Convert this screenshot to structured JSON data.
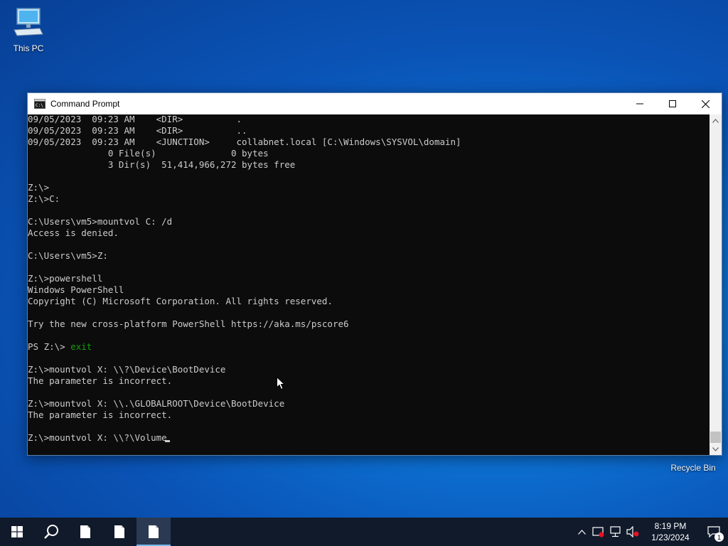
{
  "desktop": {
    "icons": [
      {
        "label": "This PC"
      },
      {
        "label": "Recycle Bin"
      }
    ]
  },
  "window": {
    "title": "Command Prompt",
    "colors": {
      "console_bg": "#0c0c0c",
      "console_fg": "#cccccc",
      "highlight": "#13a10e"
    },
    "lines": [
      "09/05/2023  09:23 AM    <DIR>          .",
      "09/05/2023  09:23 AM    <DIR>          ..",
      "09/05/2023  09:23 AM    <JUNCTION>     collabnet.local [C:\\Windows\\SYSVOL\\domain]",
      "               0 File(s)              0 bytes",
      "               3 Dir(s)  51,414,966,272 bytes free",
      "",
      "Z:\\>",
      "Z:\\>C:",
      "",
      "C:\\Users\\vm5>mountvol C: /d",
      "Access is denied.",
      "",
      "C:\\Users\\vm5>Z:",
      "",
      "Z:\\>powershell",
      "Windows PowerShell",
      "Copyright (C) Microsoft Corporation. All rights reserved.",
      "",
      "Try the new cross-platform PowerShell https://aka.ms/pscore6",
      ""
    ],
    "ps_prompt": "PS Z:\\> ",
    "ps_command": "exit",
    "lines_after": [
      "",
      "Z:\\>mountvol X: \\\\?\\Device\\BootDevice",
      "The parameter is incorrect.",
      "",
      "Z:\\>mountvol X: \\\\.\\GLOBALROOT\\Device\\BootDevice",
      "The parameter is incorrect.",
      ""
    ],
    "current_input": "Z:\\>mountvol X: \\\\?\\Volume"
  },
  "taskbar": {
    "clock_time": "8:19 PM",
    "clock_date": "1/23/2024",
    "notification_count": "1"
  }
}
